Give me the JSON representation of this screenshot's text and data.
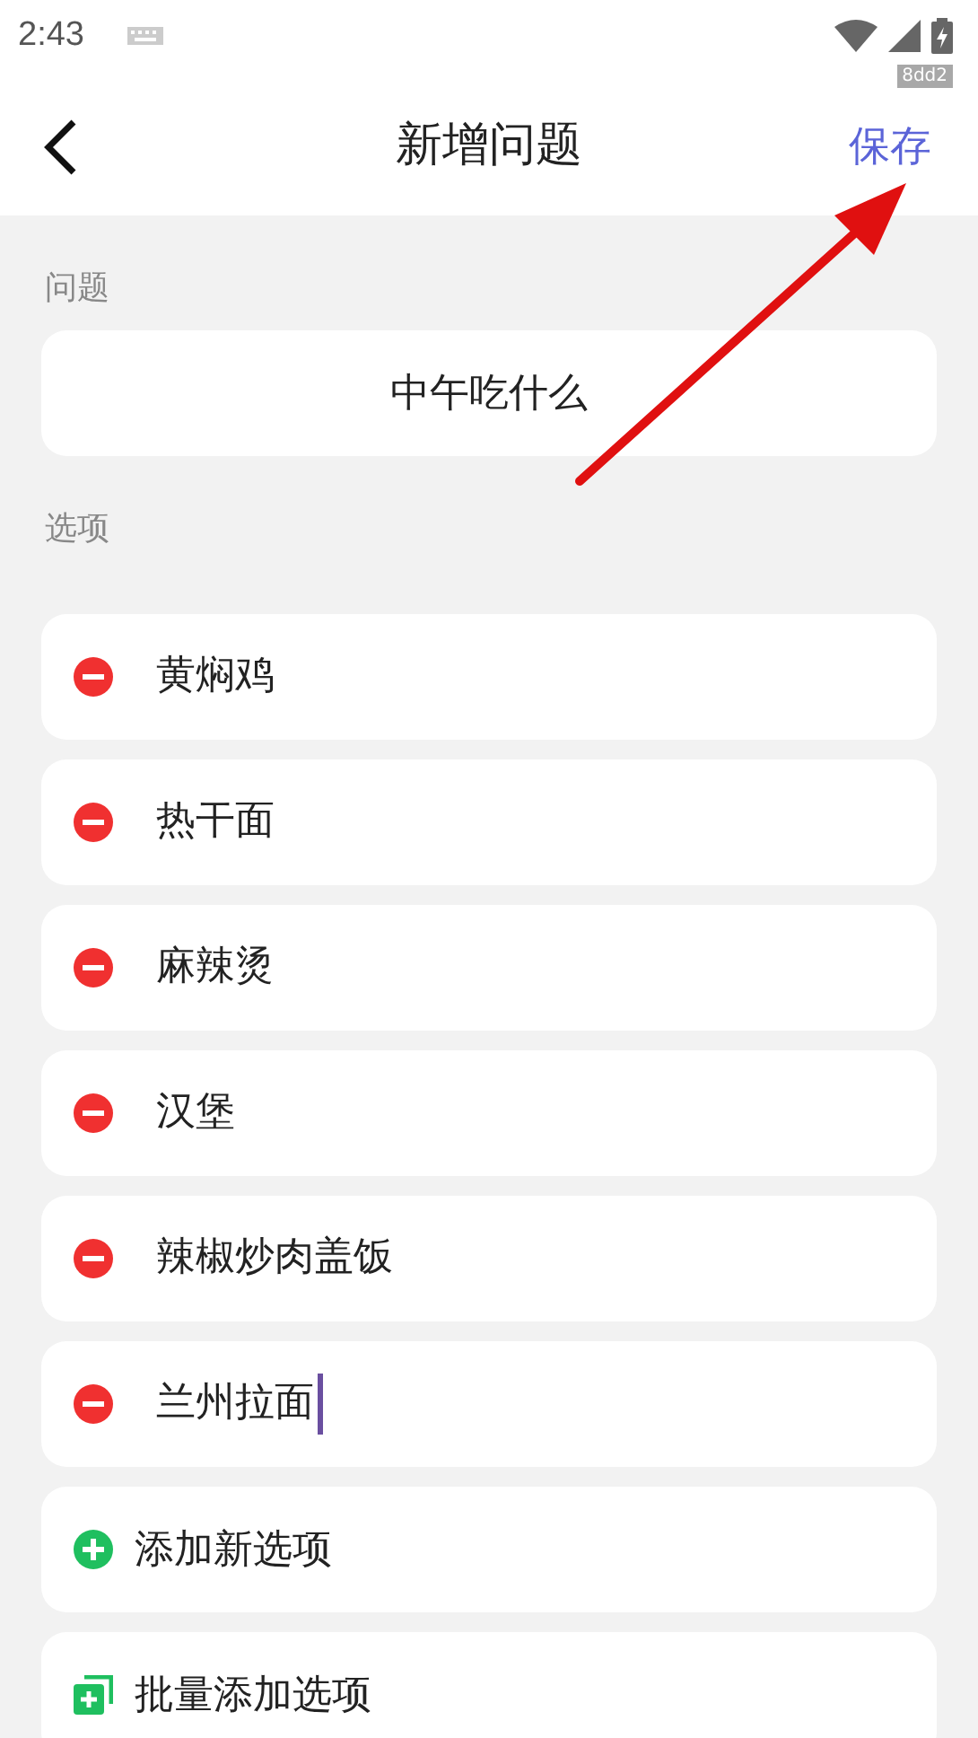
{
  "status_bar": {
    "time": "2:43",
    "badge": "8dd2"
  },
  "header": {
    "title": "新增问题",
    "save": "保存"
  },
  "question": {
    "label": "问题",
    "value": "中午吃什么"
  },
  "options_label": "选项",
  "options": [
    {
      "text": "黄焖鸡",
      "focused": false
    },
    {
      "text": "热干面",
      "focused": false
    },
    {
      "text": "麻辣烫",
      "focused": false
    },
    {
      "text": "汉堡",
      "focused": false
    },
    {
      "text": "辣椒炒肉盖饭",
      "focused": false
    },
    {
      "text": "兰州拉面",
      "focused": true
    }
  ],
  "actions": [
    {
      "kind": "add",
      "label": "添加新选项"
    },
    {
      "kind": "batch",
      "label": "批量添加选项"
    }
  ]
}
